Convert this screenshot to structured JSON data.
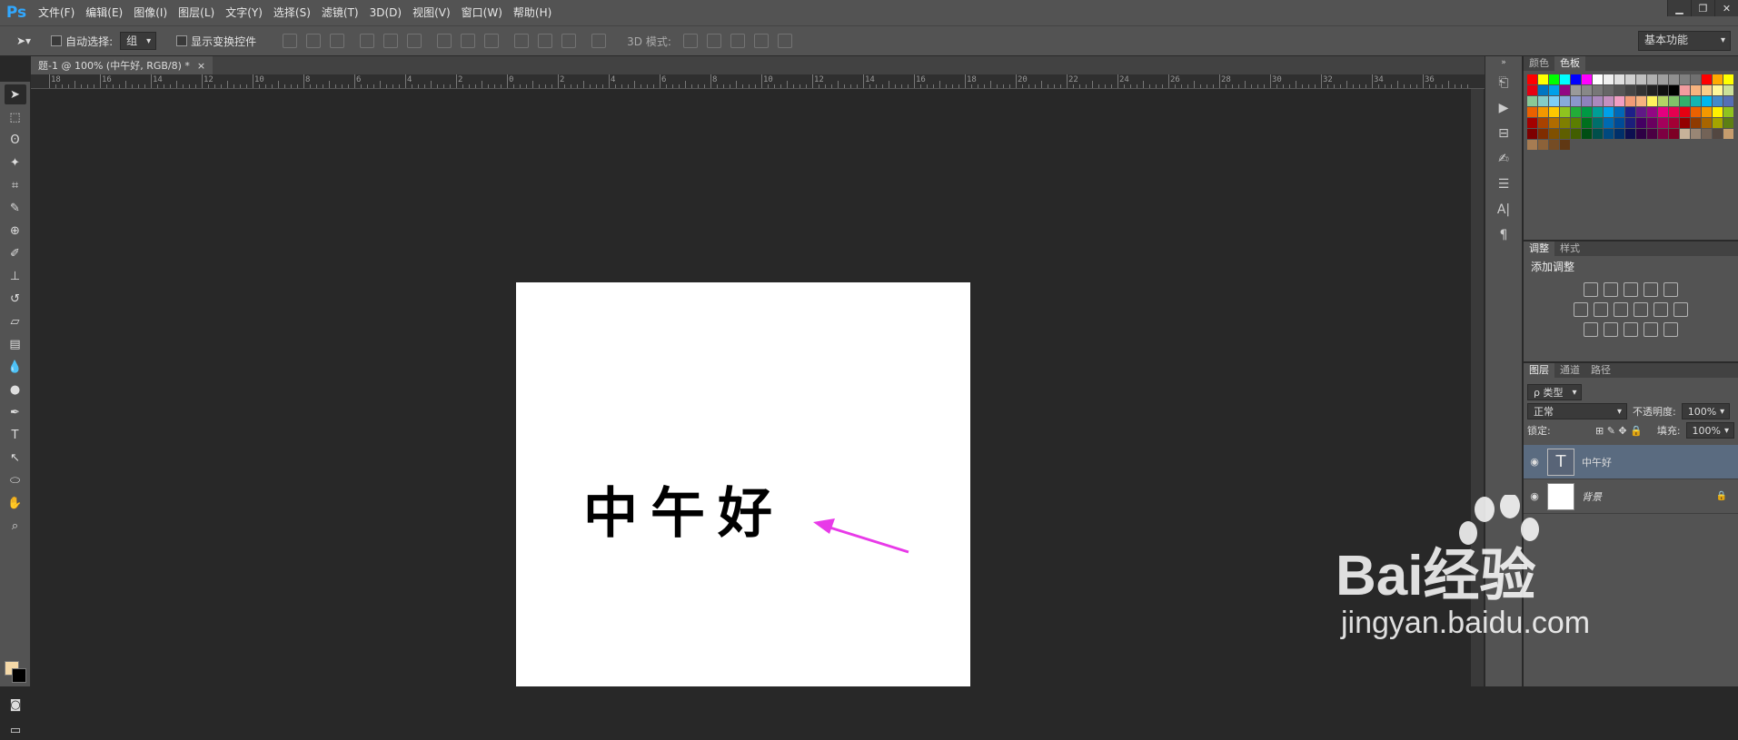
{
  "app": {
    "logo": "Ps"
  },
  "menu": [
    "文件(F)",
    "编辑(E)",
    "图像(I)",
    "图层(L)",
    "文字(Y)",
    "选择(S)",
    "滤镜(T)",
    "3D(D)",
    "视图(V)",
    "窗口(W)",
    "帮助(H)"
  ],
  "window_controls": [
    "▁",
    "❐",
    "✕"
  ],
  "options": {
    "auto_select_label": "自动选择:",
    "auto_select_value": "组",
    "transform_label": "显示变换控件",
    "mode3d_label": "3D 模式:",
    "workspace": "基本功能"
  },
  "document": {
    "tab_title": "题-1 @ 100% (中午好, RGB/8) *",
    "tab_close": "×",
    "canvas_text": "中午好"
  },
  "ruler": {
    "ticks": [
      "18",
      "16",
      "14",
      "12",
      "10",
      "8",
      "6",
      "4",
      "2",
      "0",
      "2",
      "4",
      "6",
      "8",
      "10",
      "12",
      "14",
      "16",
      "18",
      "20",
      "22",
      "24",
      "26",
      "28",
      "30",
      "32",
      "34",
      "36"
    ]
  },
  "tools": [
    "move",
    "marquee",
    "lasso",
    "magic-wand",
    "crop",
    "eyedropper",
    "healing",
    "brush",
    "stamp",
    "history-brush",
    "eraser",
    "gradient",
    "blur",
    "dodge",
    "pen",
    "type",
    "path-select",
    "ellipse",
    "hand",
    "zoom"
  ],
  "colors": {
    "foreground": "#f5d9a8",
    "background": "#000000",
    "arrow": "#e83ae8"
  },
  "swatches_panel": {
    "tabs": [
      "颜色",
      "色板"
    ]
  },
  "adjust_panel": {
    "tabs": [
      "调整",
      "样式"
    ],
    "title": "添加调整"
  },
  "layers_panel": {
    "tabs": [
      "图层",
      "通道",
      "路径"
    ],
    "filter": "ρ 类型",
    "blend": "正常",
    "opacity_label": "不透明度:",
    "opacity_value": "100%",
    "lock_label": "锁定:",
    "fill_label": "填充:",
    "fill_value": "100%",
    "layers": [
      {
        "name": "中午好",
        "thumb": "T"
      },
      {
        "name": "背景",
        "lock": "🔒"
      }
    ]
  },
  "watermark": {
    "brand": "Bai经验",
    "url": "jingyan.baidu.com"
  }
}
